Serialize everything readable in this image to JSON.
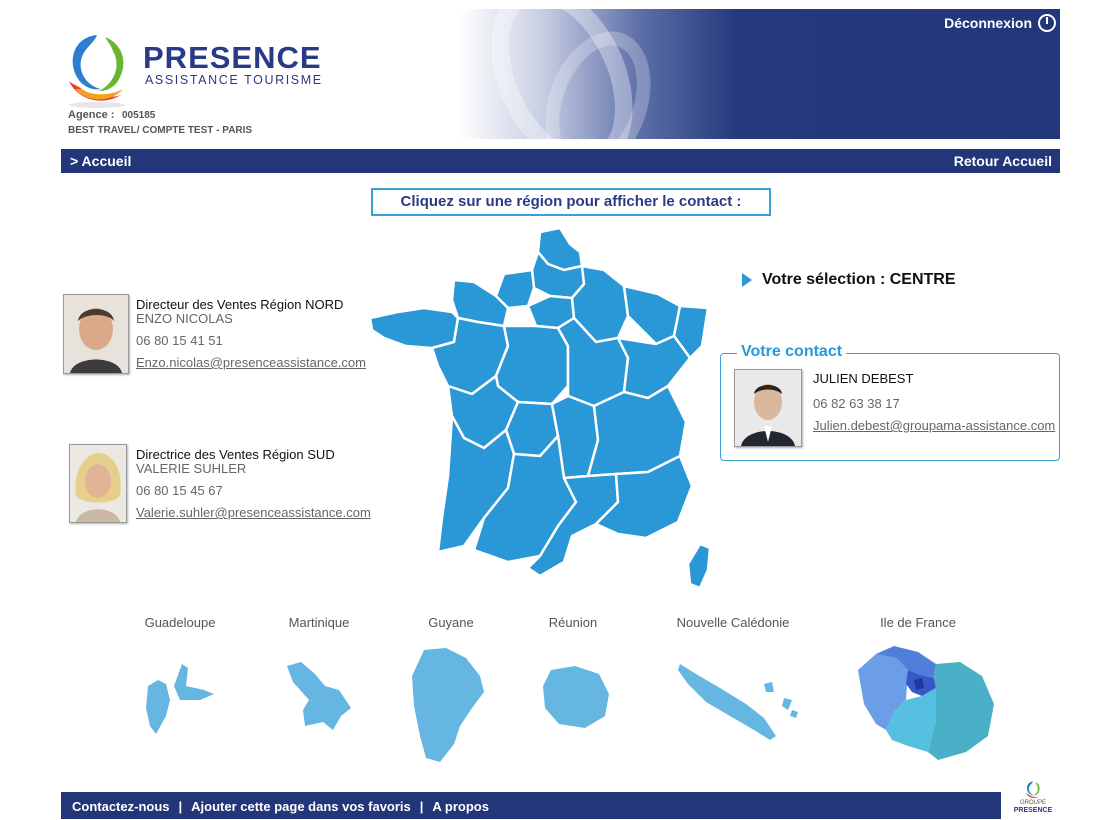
{
  "header": {
    "brand_name": "PRESENCE",
    "brand_subtitle": "ASSISTANCE TOURISME",
    "agence_label": "Agence :",
    "agence_code": "005185",
    "agence_name": "BEST TRAVEL/ COMPTE TEST - PARIS",
    "logout_label": "Déconnexion",
    "logout_icon": "power-icon"
  },
  "nav": {
    "home_label": "> Accueil",
    "back_label": "Retour Accueil"
  },
  "instruction": "Cliquez sur une région pour afficher le contact :",
  "selection": {
    "label": "Votre sélection : CENTRE"
  },
  "contacts": {
    "nord": {
      "title": "Directeur des Ventes Région NORD",
      "name": "ENZO NICOLAS",
      "phone": "06 80 15 41 51",
      "email": "Enzo.nicolas@presenceassistance.com"
    },
    "sud": {
      "title": "Directrice des Ventes Région SUD",
      "name": "VALERIE SUHLER",
      "phone": "06 80 15 45 67",
      "email": "Valerie.suhler@presenceassistance.com"
    }
  },
  "your_contact": {
    "legend": "Votre contact",
    "name": "JULIEN DEBEST",
    "phone": "06 82 63 38 17",
    "email": "Julien.debest@groupama-assistance.com"
  },
  "overseas": [
    {
      "label": "Guadeloupe"
    },
    {
      "label": "Martinique"
    },
    {
      "label": "Guyane"
    },
    {
      "label": "Réunion"
    },
    {
      "label": "Nouvelle Calédonie"
    },
    {
      "label": "Ile de France"
    }
  ],
  "footer": {
    "contact_label": "Contactez-nous",
    "favorites_label": "Ajouter cette page dans vos favoris",
    "about_label": "A propos",
    "separator": "|",
    "logo_top": "GROUPE",
    "logo_bottom": "PRESENCE"
  },
  "colors": {
    "navy": "#233679",
    "map_blue": "#2a97d6",
    "dom_blue": "#66b6e2"
  }
}
